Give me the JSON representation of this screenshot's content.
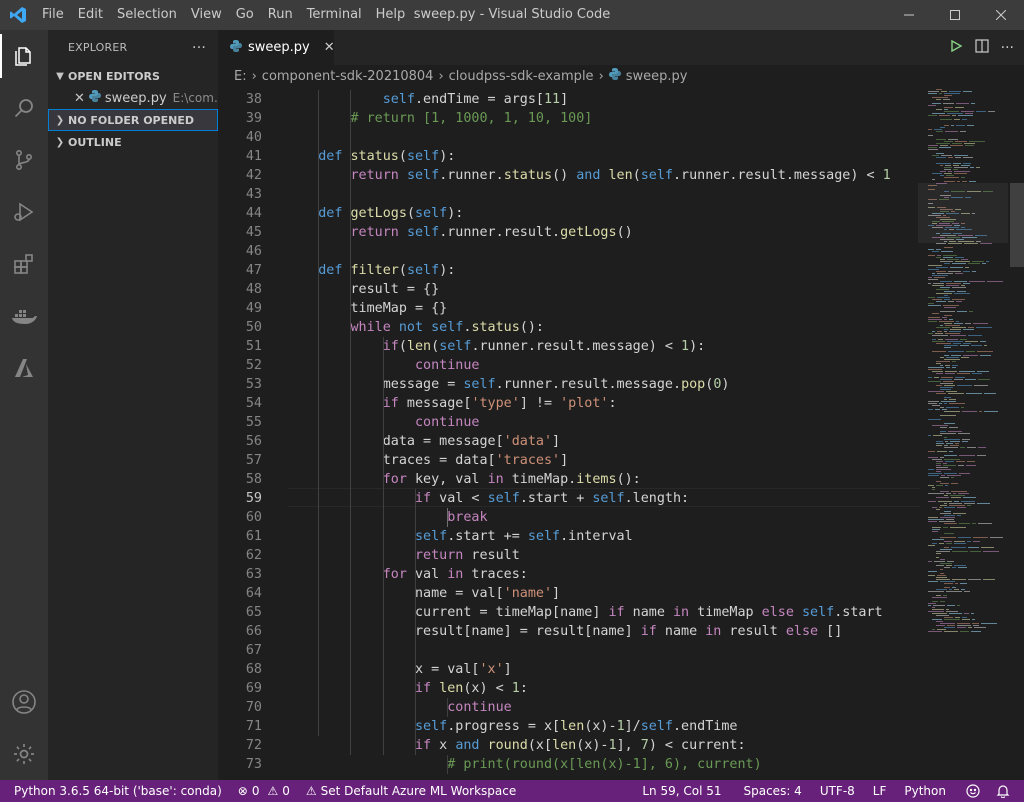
{
  "window": {
    "title": "sweep.py - Visual Studio Code",
    "menu": [
      "File",
      "Edit",
      "Selection",
      "View",
      "Go",
      "Run",
      "Terminal",
      "Help"
    ]
  },
  "sidebar": {
    "title": "EXPLORER",
    "more": "···",
    "open_editors": "OPEN EDITORS",
    "open_file": {
      "name": "sweep.py",
      "path": "E:\\com..."
    },
    "no_folder": "NO FOLDER OPENED",
    "outline": "OUTLINE"
  },
  "editor": {
    "tab_label": "sweep.py",
    "breadcrumb": [
      "E:",
      "component-sdk-20210804",
      "cloudpss-sdk-example",
      "sweep.py"
    ],
    "current_line": 59
  },
  "code_lines": [
    {
      "n": "38",
      "t": [
        [
          "",
          "            "
        ],
        [
          "k",
          "self"
        ],
        [
          "",
          ".endTime = args["
        ],
        [
          "n",
          "11"
        ],
        [
          "",
          "]"
        ]
      ]
    },
    {
      "n": "39",
      "t": [
        [
          "",
          "        "
        ],
        [
          "cm",
          "# return [1, 1000, 1, 10, 100]"
        ]
      ]
    },
    {
      "n": "40",
      "t": []
    },
    {
      "n": "41",
      "t": [
        [
          "",
          "    "
        ],
        [
          "k",
          "def"
        ],
        [
          "",
          " "
        ],
        [
          "f",
          "status"
        ],
        [
          "",
          "("
        ],
        [
          "k",
          "self"
        ],
        [
          "",
          "):"
        ]
      ]
    },
    {
      "n": "42",
      "t": [
        [
          "",
          "        "
        ],
        [
          "c",
          "return"
        ],
        [
          "",
          " "
        ],
        [
          "k",
          "self"
        ],
        [
          "",
          ".runner."
        ],
        [
          "f",
          "status"
        ],
        [
          "",
          "() "
        ],
        [
          "k",
          "and"
        ],
        [
          "",
          " "
        ],
        [
          "f",
          "len"
        ],
        [
          "",
          "("
        ],
        [
          "k",
          "self"
        ],
        [
          "",
          ".runner.result.message) < "
        ],
        [
          "n",
          "1"
        ]
      ]
    },
    {
      "n": "43",
      "t": []
    },
    {
      "n": "44",
      "t": [
        [
          "",
          "    "
        ],
        [
          "k",
          "def"
        ],
        [
          "",
          " "
        ],
        [
          "f",
          "getLogs"
        ],
        [
          "",
          "("
        ],
        [
          "k",
          "self"
        ],
        [
          "",
          "):"
        ]
      ]
    },
    {
      "n": "45",
      "t": [
        [
          "",
          "        "
        ],
        [
          "c",
          "return"
        ],
        [
          "",
          " "
        ],
        [
          "k",
          "self"
        ],
        [
          "",
          ".runner.result."
        ],
        [
          "f",
          "getLogs"
        ],
        [
          "",
          "()"
        ]
      ]
    },
    {
      "n": "46",
      "t": []
    },
    {
      "n": "47",
      "t": [
        [
          "",
          "    "
        ],
        [
          "k",
          "def"
        ],
        [
          "",
          " "
        ],
        [
          "f",
          "filter"
        ],
        [
          "",
          "("
        ],
        [
          "k",
          "self"
        ],
        [
          "",
          "):"
        ]
      ]
    },
    {
      "n": "48",
      "t": [
        [
          "",
          "        result = {}"
        ]
      ]
    },
    {
      "n": "49",
      "t": [
        [
          "",
          "        timeMap = {}"
        ]
      ]
    },
    {
      "n": "50",
      "t": [
        [
          "",
          "        "
        ],
        [
          "c",
          "while"
        ],
        [
          "",
          " "
        ],
        [
          "k",
          "not"
        ],
        [
          "",
          " "
        ],
        [
          "k",
          "self"
        ],
        [
          "",
          "."
        ],
        [
          "f",
          "status"
        ],
        [
          "",
          "():"
        ]
      ]
    },
    {
      "n": "51",
      "t": [
        [
          "",
          "            "
        ],
        [
          "c",
          "if"
        ],
        [
          "",
          "("
        ],
        [
          "f",
          "len"
        ],
        [
          "",
          "("
        ],
        [
          "k",
          "self"
        ],
        [
          "",
          ".runner.result.message) < "
        ],
        [
          "n",
          "1"
        ],
        [
          "",
          "):"
        ]
      ]
    },
    {
      "n": "52",
      "t": [
        [
          "",
          "                "
        ],
        [
          "c",
          "continue"
        ]
      ]
    },
    {
      "n": "53",
      "t": [
        [
          "",
          "            message = "
        ],
        [
          "k",
          "self"
        ],
        [
          "",
          ".runner.result.message."
        ],
        [
          "f",
          "pop"
        ],
        [
          "",
          "("
        ],
        [
          "n",
          "0"
        ],
        [
          "",
          ")"
        ]
      ]
    },
    {
      "n": "54",
      "t": [
        [
          "",
          "            "
        ],
        [
          "c",
          "if"
        ],
        [
          "",
          " message["
        ],
        [
          "s",
          "'type'"
        ],
        [
          "",
          "] != "
        ],
        [
          "s",
          "'plot'"
        ],
        [
          "",
          ":"
        ]
      ]
    },
    {
      "n": "55",
      "t": [
        [
          "",
          "                "
        ],
        [
          "c",
          "continue"
        ]
      ]
    },
    {
      "n": "56",
      "t": [
        [
          "",
          "            data = message["
        ],
        [
          "s",
          "'data'"
        ],
        [
          "",
          "]"
        ]
      ]
    },
    {
      "n": "57",
      "t": [
        [
          "",
          "            traces = data["
        ],
        [
          "s",
          "'traces'"
        ],
        [
          "",
          "]"
        ]
      ]
    },
    {
      "n": "58",
      "t": [
        [
          "",
          "            "
        ],
        [
          "c",
          "for"
        ],
        [
          "",
          " key, val "
        ],
        [
          "c",
          "in"
        ],
        [
          "",
          " timeMap."
        ],
        [
          "f",
          "items"
        ],
        [
          "",
          "():"
        ]
      ]
    },
    {
      "n": "59",
      "t": [
        [
          "",
          "                "
        ],
        [
          "c",
          "if"
        ],
        [
          "",
          " val < "
        ],
        [
          "k",
          "self"
        ],
        [
          "",
          ".start + "
        ],
        [
          "k",
          "self"
        ],
        [
          "",
          ".length:"
        ]
      ]
    },
    {
      "n": "60",
      "t": [
        [
          "",
          "                    "
        ],
        [
          "c",
          "break"
        ]
      ]
    },
    {
      "n": "61",
      "t": [
        [
          "",
          "                "
        ],
        [
          "k",
          "self"
        ],
        [
          "",
          ".start += "
        ],
        [
          "k",
          "self"
        ],
        [
          "",
          ".interval"
        ]
      ]
    },
    {
      "n": "62",
      "t": [
        [
          "",
          "                "
        ],
        [
          "c",
          "return"
        ],
        [
          "",
          " result"
        ]
      ]
    },
    {
      "n": "63",
      "t": [
        [
          "",
          "            "
        ],
        [
          "c",
          "for"
        ],
        [
          "",
          " val "
        ],
        [
          "c",
          "in"
        ],
        [
          "",
          " traces:"
        ]
      ]
    },
    {
      "n": "64",
      "t": [
        [
          "",
          "                name = val["
        ],
        [
          "s",
          "'name'"
        ],
        [
          "",
          "]"
        ]
      ]
    },
    {
      "n": "65",
      "t": [
        [
          "",
          "                current = timeMap[name] "
        ],
        [
          "c",
          "if"
        ],
        [
          "",
          " name "
        ],
        [
          "c",
          "in"
        ],
        [
          "",
          " timeMap "
        ],
        [
          "c",
          "else"
        ],
        [
          "",
          " "
        ],
        [
          "k",
          "self"
        ],
        [
          "",
          ".start"
        ]
      ]
    },
    {
      "n": "66",
      "t": [
        [
          "",
          "                result[name] = result[name] "
        ],
        [
          "c",
          "if"
        ],
        [
          "",
          " name "
        ],
        [
          "c",
          "in"
        ],
        [
          "",
          " result "
        ],
        [
          "c",
          "else"
        ],
        [
          "",
          " []"
        ]
      ]
    },
    {
      "n": "67",
      "t": []
    },
    {
      "n": "68",
      "t": [
        [
          "",
          "                x = val["
        ],
        [
          "s",
          "'x'"
        ],
        [
          "",
          "]"
        ]
      ]
    },
    {
      "n": "69",
      "t": [
        [
          "",
          "                "
        ],
        [
          "c",
          "if"
        ],
        [
          "",
          " "
        ],
        [
          "f",
          "len"
        ],
        [
          "",
          "(x) < "
        ],
        [
          "n",
          "1"
        ],
        [
          "",
          ":"
        ]
      ]
    },
    {
      "n": "70",
      "t": [
        [
          "",
          "                    "
        ],
        [
          "c",
          "continue"
        ]
      ]
    },
    {
      "n": "71",
      "t": [
        [
          "",
          "                "
        ],
        [
          "k",
          "self"
        ],
        [
          "",
          ".progress = x["
        ],
        [
          "f",
          "len"
        ],
        [
          "",
          "(x)-"
        ],
        [
          "n",
          "1"
        ],
        [
          "",
          "]/"
        ],
        [
          "k",
          "self"
        ],
        [
          "",
          ".endTime"
        ]
      ]
    },
    {
      "n": "72",
      "t": [
        [
          "",
          "                "
        ],
        [
          "c",
          "if"
        ],
        [
          "",
          " x "
        ],
        [
          "k",
          "and"
        ],
        [
          "",
          " "
        ],
        [
          "f",
          "round"
        ],
        [
          "",
          "(x["
        ],
        [
          "f",
          "len"
        ],
        [
          "",
          "(x)-"
        ],
        [
          "n",
          "1"
        ],
        [
          "",
          "], "
        ],
        [
          "n",
          "7"
        ],
        [
          "",
          ") < current:"
        ]
      ]
    },
    {
      "n": "73",
      "t": [
        [
          "",
          "                    "
        ],
        [
          "cm",
          "# print(round(x[len(x)-1], 6), current)"
        ]
      ]
    }
  ],
  "statusbar": {
    "python": "Python 3.6.5 64-bit ('base': conda)",
    "errors": "0",
    "warnings": "0",
    "azure": "Set Default Azure ML Workspace",
    "position": "Ln 59, Col 51",
    "spaces": "Spaces: 4",
    "encoding": "UTF-8",
    "eol": "LF",
    "language": "Python"
  },
  "colors": {
    "statusbar": "#68217a",
    "activitybar": "#333333",
    "sidebar": "#252526",
    "editor": "#1e1e1e"
  }
}
